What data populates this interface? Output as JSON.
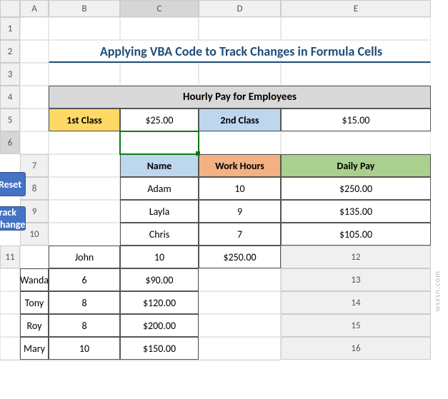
{
  "columns": [
    "A",
    "B",
    "C",
    "D",
    "E"
  ],
  "title": "Applying VBA Code to Track Changes in Formula Cells",
  "subhead": "Hourly Pay for Employees",
  "class1_label": "1st Class",
  "class1_rate": "$25.00",
  "class2_label": "2nd Class",
  "class2_rate": "$15.00",
  "headers": {
    "name": "Name",
    "work": "Work Hours",
    "pay": "Daily Pay"
  },
  "rows": [
    {
      "name": "Adam",
      "work": "10",
      "pay": "$250.00"
    },
    {
      "name": "Layla",
      "work": "9",
      "pay": "$135.00"
    },
    {
      "name": "Chris",
      "work": "7",
      "pay": "$105.00"
    },
    {
      "name": "John",
      "work": "10",
      "pay": "$250.00"
    },
    {
      "name": "Wanda",
      "work": "6",
      "pay": "$90.00"
    },
    {
      "name": "Tony",
      "work": "8",
      "pay": "$120.00"
    },
    {
      "name": "Roy",
      "work": "8",
      "pay": "$200.00"
    },
    {
      "name": "Mary",
      "work": "10",
      "pay": "$150.00"
    }
  ],
  "buttons": {
    "reset": "Reset",
    "track": "Track Change"
  },
  "watermark": "wsxsn.com"
}
